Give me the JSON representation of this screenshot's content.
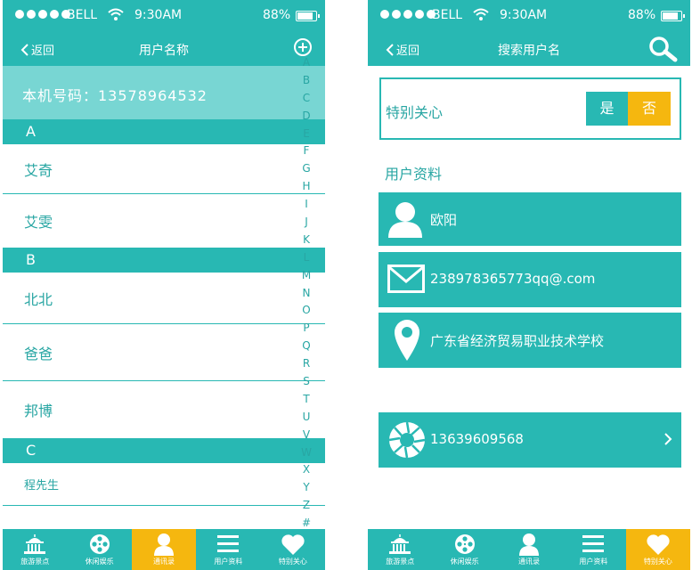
{
  "status_bar": {
    "carrier": "BELL",
    "time": "9:30AM",
    "battery_percent": "88%",
    "battery_level": 0.88
  },
  "left_screen": {
    "nav": {
      "back_label": "返回",
      "title": "用户名称"
    },
    "phone_label": "本机号码：13578964532",
    "sections": [
      {
        "letter": "A",
        "contacts": [
          "艾奇",
          "艾雯"
        ]
      },
      {
        "letter": "B",
        "contacts": [
          "北北",
          "爸爸",
          "邦博"
        ]
      },
      {
        "letter": "C",
        "contacts": [
          "程先生"
        ]
      }
    ],
    "alpha_index": [
      "A",
      "B",
      "C",
      "D",
      "E",
      "F",
      "G",
      "H",
      "I",
      "J",
      "K",
      "L",
      "M",
      "N",
      "O",
      "P",
      "Q",
      "R",
      "S",
      "T",
      "U",
      "V",
      "W",
      "X",
      "Y",
      "Z",
      "#"
    ]
  },
  "right_screen": {
    "nav": {
      "back_label": "返回",
      "title": "搜索用户名"
    },
    "special_care": {
      "label": "特别关心",
      "yes_label": "是",
      "no_label": "否"
    },
    "profile_heading": "用户资料",
    "name": "欧阳",
    "email": "238978365773qq@.com",
    "address": "广东省经济贸易职业技术学校",
    "phone": "13639609568"
  },
  "tabbar": {
    "tabs": [
      {
        "label": "旅游景点",
        "icon": "landmark-icon"
      },
      {
        "label": "休闲娱乐",
        "icon": "film-reel-icon"
      },
      {
        "label": "通讯录",
        "icon": "person-icon"
      },
      {
        "label": "用户资料",
        "icon": "menu-icon"
      },
      {
        "label": "特别关心",
        "icon": "heart-icon"
      }
    ],
    "left_active_index": 2,
    "right_active_index": 4
  },
  "colors": {
    "primary": "#28b8b3",
    "light": "#78d6d3",
    "accent": "#f5b70f",
    "text_teal": "#28a6a3"
  }
}
